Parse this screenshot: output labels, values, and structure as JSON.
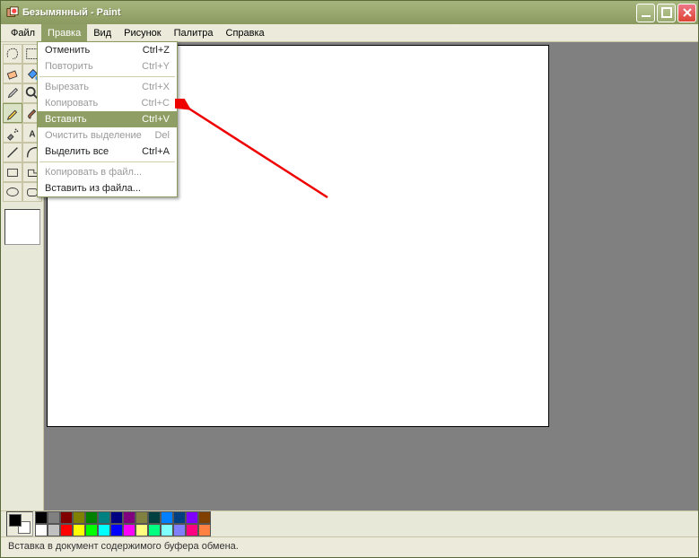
{
  "titlebar": {
    "title": "Безымянный - Paint"
  },
  "menubar": {
    "items": [
      {
        "label": "Файл"
      },
      {
        "label": "Правка",
        "active": true
      },
      {
        "label": "Вид"
      },
      {
        "label": "Рисунок"
      },
      {
        "label": "Палитра"
      },
      {
        "label": "Справка"
      }
    ]
  },
  "editmenu": {
    "items": [
      {
        "label": "Отменить",
        "shortcut": "Ctrl+Z",
        "enabled": true
      },
      {
        "label": "Повторить",
        "shortcut": "Ctrl+Y",
        "enabled": false
      },
      {
        "sep": true
      },
      {
        "label": "Вырезать",
        "shortcut": "Ctrl+X",
        "enabled": false
      },
      {
        "label": "Копировать",
        "shortcut": "Ctrl+C",
        "enabled": false
      },
      {
        "label": "Вставить",
        "shortcut": "Ctrl+V",
        "enabled": true,
        "highlight": true
      },
      {
        "label": "Очистить выделение",
        "shortcut": "Del",
        "enabled": false
      },
      {
        "label": "Выделить все",
        "shortcut": "Ctrl+A",
        "enabled": true
      },
      {
        "sep": true
      },
      {
        "label": "Копировать в файл...",
        "shortcut": "",
        "enabled": false
      },
      {
        "label": "Вставить из файла...",
        "shortcut": "",
        "enabled": true
      }
    ]
  },
  "tools": [
    "freeform-select",
    "rect-select",
    "eraser",
    "fill",
    "picker",
    "magnifier",
    "pencil",
    "brush",
    "airbrush",
    "text",
    "line",
    "curve",
    "rectangle",
    "polygon",
    "ellipse",
    "rounded-rectangle"
  ],
  "selected_tool": "pencil",
  "palette": {
    "row1": [
      "#000000",
      "#808080",
      "#800000",
      "#808000",
      "#008000",
      "#008080",
      "#000080",
      "#800080",
      "#808040",
      "#004040",
      "#0080ff",
      "#004080",
      "#8000ff",
      "#804000"
    ],
    "row2": [
      "#ffffff",
      "#c0c0c0",
      "#ff0000",
      "#ffff00",
      "#00ff00",
      "#00ffff",
      "#0000ff",
      "#ff00ff",
      "#ffff80",
      "#00ff80",
      "#80ffff",
      "#8080ff",
      "#ff0080",
      "#ff8040"
    ],
    "fg": "#000000",
    "bg": "#ffffff"
  },
  "statusbar": {
    "text": "Вставка в документ содержимого буфера обмена."
  }
}
